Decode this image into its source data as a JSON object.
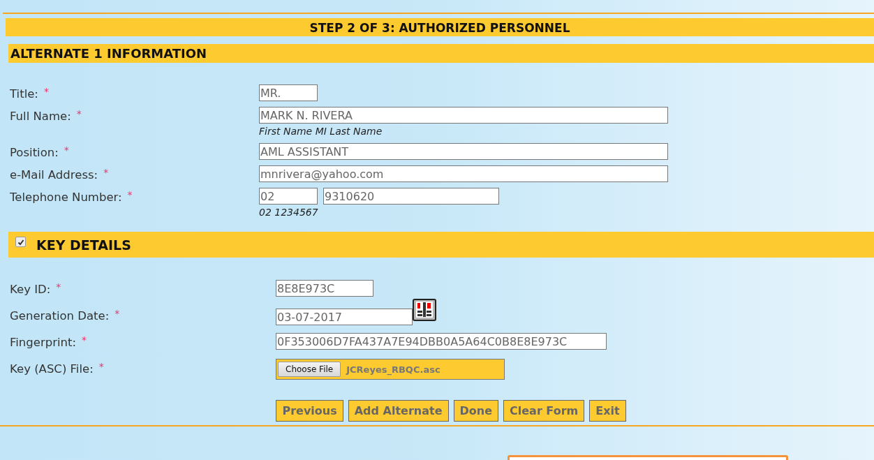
{
  "step_title": "STEP 2 OF 3: AUTHORIZED PERSONNEL",
  "sections": [
    {
      "title": "ALTERNATE 1 INFORMATION",
      "rows": [
        {
          "kind": "text",
          "label": "Title:",
          "required_mark": "*",
          "values": [
            "MR."
          ]
        },
        {
          "kind": "text",
          "label": "Full Name:",
          "required_mark": "*",
          "values": [
            "MARK N. RIVERA"
          ],
          "hint": "First Name MI Last Name"
        },
        {
          "kind": "text",
          "label": "Position:",
          "required_mark": "*",
          "values": [
            "AML ASSISTANT"
          ]
        },
        {
          "kind": "text",
          "label": "e-Mail Address:",
          "required_mark": "*",
          "values": [
            "mnrivera@yahoo.com"
          ]
        },
        {
          "kind": "phone",
          "label": "Telephone Number:",
          "required_mark": "*",
          "values": [
            "02",
            "9310620"
          ],
          "hint": "02 1234567"
        }
      ]
    },
    {
      "title": "KEY DETAILS",
      "checkbox": {
        "checked": true
      },
      "rows": [
        {
          "kind": "text",
          "label": "Key ID:",
          "required_mark": "*",
          "values": [
            "8E8E973C"
          ]
        },
        {
          "kind": "date",
          "label": "Generation Date:",
          "required_mark": "*",
          "values": [
            "03-07-2017"
          ]
        },
        {
          "kind": "text",
          "label": "Fingerprint:",
          "required_mark": "*",
          "values": [
            "0F353006D7FA437A7E94DBB0A5A64C0B8E8E973C"
          ]
        },
        {
          "kind": "file",
          "label": "Key (ASC) File:",
          "required_mark": "*",
          "button": "Choose File",
          "file_name": "JCReyes_RBQC.asc"
        }
      ]
    }
  ],
  "buttons": [
    "Previous",
    "Add Alternate",
    "Done",
    "Clear Form",
    "Exit"
  ]
}
